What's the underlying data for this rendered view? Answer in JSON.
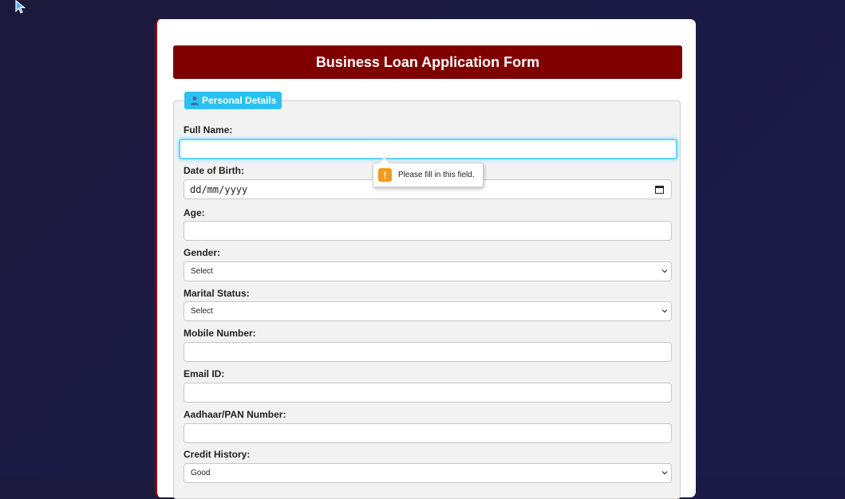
{
  "form": {
    "title": "Business Loan Application Form",
    "section_label": "Personal Details",
    "section_icon": "person-icon",
    "fields": {
      "full_name": {
        "label": "Full Name:",
        "value": ""
      },
      "dob": {
        "label": "Date of Birth:",
        "value": "dd/mm/yyyy",
        "icon": "calendar-icon"
      },
      "age": {
        "label": "Age:",
        "value": ""
      },
      "gender": {
        "label": "Gender:",
        "value": "Select"
      },
      "marital": {
        "label": "Marital Status:",
        "value": "Select"
      },
      "mobile": {
        "label": "Mobile Number:",
        "value": ""
      },
      "email": {
        "label": "Email ID:",
        "value": ""
      },
      "aadhaar": {
        "label": "Aadhaar/PAN Number:",
        "value": ""
      },
      "credit": {
        "label": "Credit History:",
        "value": "Good"
      }
    }
  },
  "validation_tooltip": {
    "icon": "warning-icon",
    "icon_glyph": "!",
    "message": "Please fill in this field."
  },
  "colors": {
    "header": "#800000",
    "legend": "#29c2f0",
    "focus_ring": "#5fd3ff",
    "warning": "#f29a1e",
    "background": "#1c1a3c"
  }
}
